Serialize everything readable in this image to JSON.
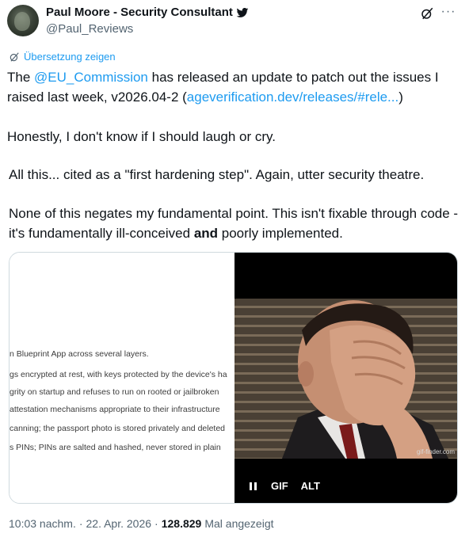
{
  "author": {
    "display_name": "Paul Moore - Security Consultant",
    "handle": "@Paul_Reviews"
  },
  "translate_label": "Übersetzung zeigen",
  "tweet": {
    "line1_pre": "The ",
    "mention": "@EU_Commission",
    "line1_post": " has released an update to patch out the issues I raised last week, v2026.04-2 (",
    "url": "ageverification.dev/releases/#rele...",
    "line1_end": ")",
    "line2": "Honestly, I don't know if I should laugh or cry.",
    "line3": "All this... cited as a \"first hardening step\".  Again, utter security theatre.",
    "line4_pre": "None of this negates my fundamental point.  This isn't fixable through code - it's fundamentally ill-conceived ",
    "line4_bold": "and",
    "line4_post": " poorly implemented."
  },
  "media": {
    "doc_lines": [
      "n Blueprint App across several layers.",
      "gs encrypted at rest, with keys protected by the device's ha",
      "grity on startup and refuses to run on rooted or jailbroken",
      "attestation mechanisms appropriate to their infrastructure",
      "canning; the passport photo is stored privately and deleted",
      "s PINs; PINs are salted and hashed, never stored in plain"
    ],
    "gif_watermark": "gif-finder.com",
    "gif_label": "GIF",
    "alt_label": "ALT"
  },
  "footer": {
    "time": "10:03 nachm.",
    "sep1": "·",
    "date": "22. Apr. 2026",
    "sep2": "·",
    "views": "128.829",
    "views_label": "Mal angezeigt"
  },
  "colors": {
    "link": "#1d9bf0",
    "secondary": "#536471",
    "text": "#0f1419"
  }
}
